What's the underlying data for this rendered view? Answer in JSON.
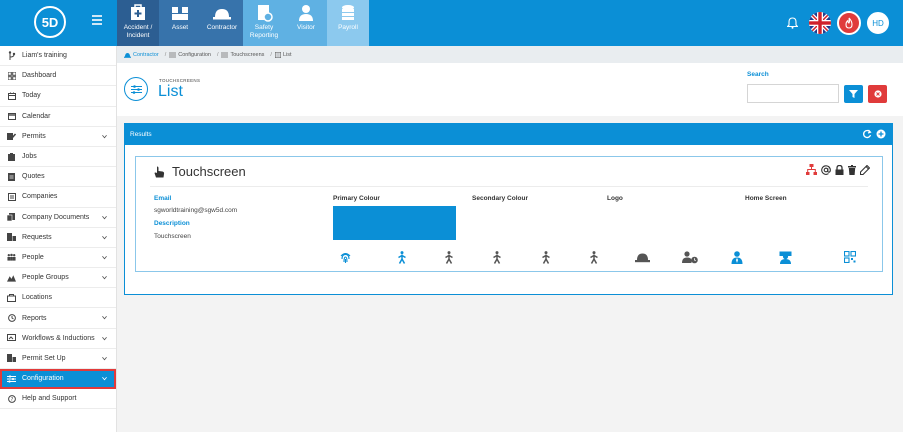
{
  "app": {
    "logo_text": "5D",
    "colors": {
      "brand": "#0b8fd6",
      "danger": "#e03b3b",
      "primary_colour_swatch": "#0b8fd6"
    }
  },
  "modules": [
    {
      "label": "Accident / Incident",
      "icon": "first-aid-icon"
    },
    {
      "label": "Asset",
      "icon": "boxes-icon"
    },
    {
      "label": "Contractor",
      "icon": "hardhat-icon"
    },
    {
      "label": "Safety Reporting",
      "icon": "report-icon"
    },
    {
      "label": "Visitor",
      "icon": "user-icon"
    },
    {
      "label": "Payroll",
      "icon": "coins-icon"
    }
  ],
  "user": {
    "initials": "HD"
  },
  "sidebar": {
    "items": [
      {
        "label": "Liam's training",
        "icon": "branch-icon"
      },
      {
        "label": "Dashboard",
        "icon": "grid-icon"
      },
      {
        "label": "Today",
        "icon": "calendar-icon"
      },
      {
        "label": "Calendar",
        "icon": "calendar-blank-icon"
      },
      {
        "label": "Permits",
        "icon": "permit-icon"
      },
      {
        "label": "Jobs",
        "icon": "clipboard-icon"
      },
      {
        "label": "Quotes",
        "icon": "document-icon"
      },
      {
        "label": "Companies",
        "icon": "building-icon"
      },
      {
        "label": "Company Documents",
        "icon": "docs-icon"
      },
      {
        "label": "Requests",
        "icon": "request-icon"
      },
      {
        "label": "People",
        "icon": "people-icon"
      },
      {
        "label": "People Groups",
        "icon": "group-icon"
      },
      {
        "label": "Locations",
        "icon": "location-icon"
      },
      {
        "label": "Reports",
        "icon": "clock-icon"
      },
      {
        "label": "Workflows & Inductions",
        "icon": "workflow-icon"
      },
      {
        "label": "Permit Set Up",
        "icon": "setup-icon"
      },
      {
        "label": "Configuration",
        "icon": "config-icon"
      },
      {
        "label": "Help and Support",
        "icon": "help-icon"
      }
    ]
  },
  "breadcrumb": [
    "Contractor",
    "Configuration",
    "Touchscreens",
    "List"
  ],
  "header": {
    "subtitle": "TOUCHSCREENS",
    "title": "List",
    "search_label": "Search",
    "search_value": ""
  },
  "results": {
    "title": "Results",
    "card": {
      "name": "Touchscreen",
      "email_label": "Email",
      "email_value": "sgworldtraining@sgw5d.com",
      "description_label": "Description",
      "description_value": "Touchscreen",
      "primary_colour_label": "Primary Colour",
      "secondary_colour_label": "Secondary Colour",
      "logo_label": "Logo",
      "home_screen_label": "Home Screen",
      "home_icons": [
        "fingerprint-icon",
        "walking-icon",
        "walking-icon",
        "walking-icon",
        "walking-icon",
        "walking-icon",
        "hardhat-icon",
        "user-clock-icon",
        "user-tie-icon",
        "graduate-icon",
        "qrcode-icon"
      ]
    }
  }
}
